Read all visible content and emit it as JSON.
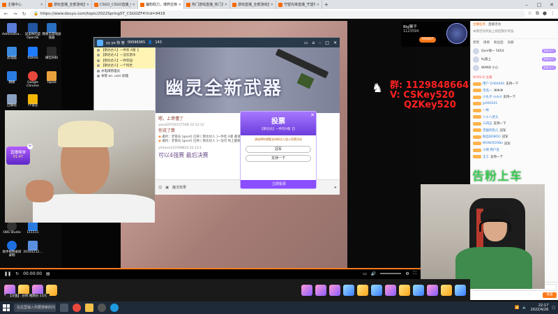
{
  "browser": {
    "tabs": [
      {
        "label": "主播中心",
        "active": false
      },
      {
        "label": "游玩直播_全部游戏直播_斗鱼直播",
        "active": false
      },
      {
        "label": "CSGO_CSGO直播_CSGO直播",
        "active": false
      },
      {
        "label": "骗粉助力，博弈拉锋_斗鱼直播",
        "active": true
      },
      {
        "label": "热门游戏直播_热门游戏视频_斗鱼",
        "active": false
      },
      {
        "label": "游戏直播_全部游戏直播_斗鱼直播",
        "active": false
      },
      {
        "label": "守望先锋直播_守望先锋直播吧",
        "active": false
      }
    ],
    "url": "https://www.douyu.com/topic/2022SpringST_CSGOZF4?rid=9418"
  },
  "desktop_icons": [
    {
      "label": "Administra...",
      "color": "#5a7bd6"
    },
    {
      "label": "说说你的是OpenSE",
      "color": "#2255a0"
    },
    {
      "label": "网易云游戏加速器",
      "color": "#2a6fc0"
    },
    {
      "label": "此电脑",
      "color": "#3a8be0"
    },
    {
      "label": "ToDesk",
      "color": "#1e7bff"
    },
    {
      "label": "微信扫码",
      "color": "#2a2a2a"
    },
    {
      "label": "网络",
      "color": "#2a7be0"
    },
    {
      "label": "Google Chrome",
      "color": "#e8473c"
    },
    {
      "label": "Tapad",
      "color": "#e8a13c"
    },
    {
      "label": "回收站",
      "color": "#8aa0c0"
    },
    {
      "label": "YY语音",
      "color": "#f2b705"
    },
    {
      "label": "OBS Studio",
      "color": "#333333"
    },
    {
      "label": "111111",
      "color": "#2a7be0"
    },
    {
      "label": "助手视频录屏录制",
      "color": "#1e6fe0"
    },
    {
      "label": "20181212...",
      "color": "#5a8fe0"
    }
  ],
  "streamer": {
    "name": "Big猴子",
    "fans": "1123594",
    "follow_label": "090867"
  },
  "qq_window": {
    "title": "yy yo 你 管",
    "ids": "00096365",
    "count": "143",
    "contacts": [
      {
        "label": "【斯达达人】一件欢 A版【",
        "highlight": true
      },
      {
        "label": "【斯达达人】一渲云游水",
        "highlight": true
      },
      {
        "label": "【斯达达人】一件欢园",
        "highlight": true
      },
      {
        "label": "【斯达达人】一个阿世",
        "highlight": true
      },
      {
        "label": "水电煤管理员",
        "highlight": false
      },
      {
        "label": "本管 an. user 助理",
        "highlight": false
      }
    ],
    "banner_text": "幽灵全新武器",
    "messages": [
      {
        "head": "",
        "body": "嗯，上哥懂了"
      },
      {
        "head": "yayal2072015750B 22:12:12",
        "body": "你说了算"
      }
    ],
    "system_lines": [
      "邀约：老管员 [good] 已将 [ 斯达达人 ]一件欢 A版 邀请",
      "邀约：老管员 [good] 已将 [ 斯达达人 ]一渲可 你上最新..."
    ],
    "last_msg_head": "yinhuse123768824 22:13:1",
    "last_msg": "可以4强赛 最后决赛",
    "input_tools": [
      "表情",
      "图片",
      "魔法效果"
    ]
  },
  "vote": {
    "title": "投票",
    "subtitle": "【斯达达】一件欢A版【】",
    "question": "请选择你想要支持的达人加入投票活动",
    "options": [
      "冠军",
      "支持一下"
    ],
    "button": "立即投票"
  },
  "cam1_badge": {
    "label": "直播榜单",
    "num": "01:47"
  },
  "overlay": {
    "line1": "群: 1129848664",
    "line2": "V: CSKey520",
    "line3": "QZKey520",
    "green": "告粉上车"
  },
  "chat": {
    "tabs": [
      "主播任务",
      "直播活动"
    ],
    "notice": "本期活动奖励上榜后额外奖励",
    "rank_tabs": [
      "贵宾",
      "周榜",
      "粉丝团",
      "贡献"
    ],
    "rank": [
      {
        "name": "Quin钱一 5654",
        "tag": "超级会员"
      },
      {
        "name": "lkj爱上",
        "tag": "超级会员"
      },
      {
        "name": "WAND 小心",
        "tag": "超级会员"
      }
    ],
    "messages": [
      {
        "user": "用户 ZH04400",
        "text": "支持一下",
        "sys": false
      },
      {
        "user": "杰克一",
        "text": "冲冲冲",
        "sys": false
      },
      {
        "user": "小丸子 rsdcd",
        "text": "支持一下",
        "sys": false
      },
      {
        "user": "jp940201",
        "text": "",
        "sys": false
      },
      {
        "user": "一枚",
        "text": "",
        "sys": false
      },
      {
        "user": "八十八老头",
        "text": "",
        "sys": false
      },
      {
        "user": "三四五",
        "text": "支持一下",
        "sys": false
      },
      {
        "user": "无敌的狗儿",
        "text": "冠军",
        "sys": false
      },
      {
        "user": "粉丝BOBOO",
        "text": "冠军",
        "sys": false
      },
      {
        "user": "WOWOOOBo",
        "text": "冠军",
        "sys": false
      },
      {
        "user": "小明 用户名",
        "text": "",
        "sys": false
      },
      {
        "user": "王工",
        "text": "支持一下",
        "sys": false
      }
    ],
    "system_badge": "WORLD 主播",
    "input_placeholder": "这里输入聊天内容",
    "send_label": "发送"
  },
  "controls": {
    "time": "00:00:00",
    "progress_percent": 100
  },
  "gift_bar": {
    "sub_msg": "【斗鱼】 分听 视频分 11/1"
  },
  "taskbar": {
    "search_placeholder": "在这里输入你要搜索的内容",
    "time": "22:17",
    "date": "2022/4/26"
  }
}
